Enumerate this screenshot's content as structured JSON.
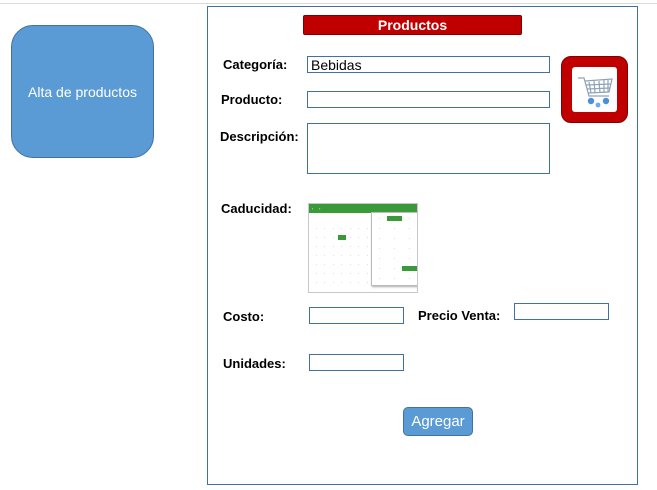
{
  "sidebar": {
    "tile_label": "Alta de productos"
  },
  "form": {
    "title": "Productos",
    "category": {
      "label": "Categoría:",
      "value": "Bebidas"
    },
    "product": {
      "label": "Producto:",
      "value": ""
    },
    "description": {
      "label": "Descripción:",
      "value": ""
    },
    "expiry": {
      "label": "Caducidad:"
    },
    "cost": {
      "label": "Costo:",
      "value": ""
    },
    "sale_price": {
      "label": "Precio Venta:",
      "value": ""
    },
    "units": {
      "label": "Unidades:",
      "value": ""
    },
    "submit_label": "Agregar"
  },
  "icons": {
    "cart": "shopping-cart-icon"
  },
  "colors": {
    "accent_blue": "#5b9bd5",
    "border_blue": "#41719c",
    "brand_red": "#c00000",
    "calendar_green": "#3a9a3a"
  }
}
